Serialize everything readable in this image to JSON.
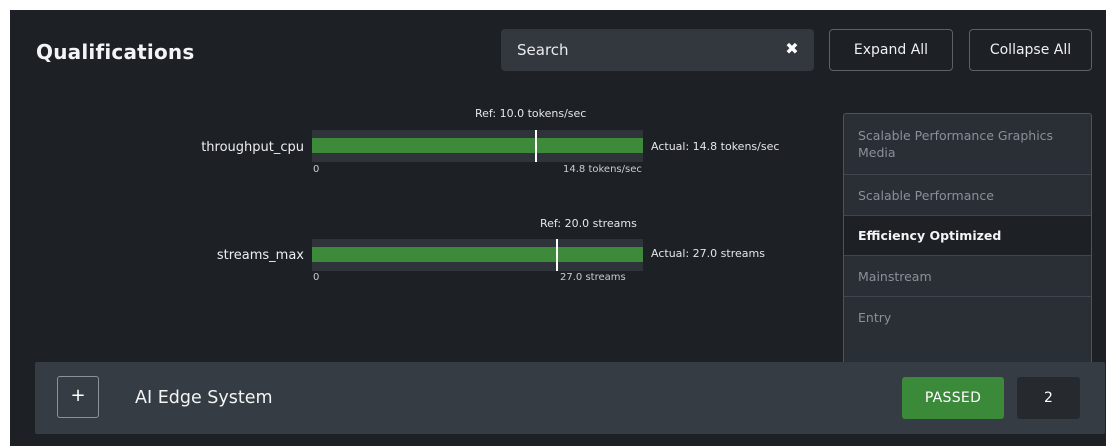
{
  "header": {
    "title": "Qualifications",
    "search": {
      "value": "Search"
    },
    "expand_label": "Expand All",
    "collapse_label": "Collapse All",
    "clear_icon": "close-icon"
  },
  "metrics": [
    {
      "name": "throughput_cpu",
      "ref_label": "Ref: 10.0 tokens/sec",
      "actual_label": "Actual: 14.8 tokens/sec",
      "axis_min_label": "0",
      "axis_max_label": "14.8 tokens/sec",
      "value": 14.8,
      "reference": 10.0,
      "axis_max": 14.8
    },
    {
      "name": "streams_max",
      "ref_label": "Ref: 20.0 streams",
      "actual_label": "Actual: 27.0 streams",
      "axis_min_label": "0",
      "axis_max_label": "27.0 streams",
      "value": 27.0,
      "reference": 20.0,
      "axis_max": 27.0
    }
  ],
  "filters": [
    {
      "label": "Scalable Performance Graphics Media",
      "active": false
    },
    {
      "label": "Scalable Performance",
      "active": false
    },
    {
      "label": "Efficiency Optimized",
      "active": true
    },
    {
      "label": "Mainstream",
      "active": false
    },
    {
      "label": "Entry",
      "active": false
    }
  ],
  "system": {
    "expand_symbol": "+",
    "name": "AI Edge System",
    "status": "PASSED",
    "count": "2"
  },
  "colors": {
    "bar_fill": "#3e8a3b",
    "passed": "#3a8a3a",
    "background": "#1d2024"
  }
}
